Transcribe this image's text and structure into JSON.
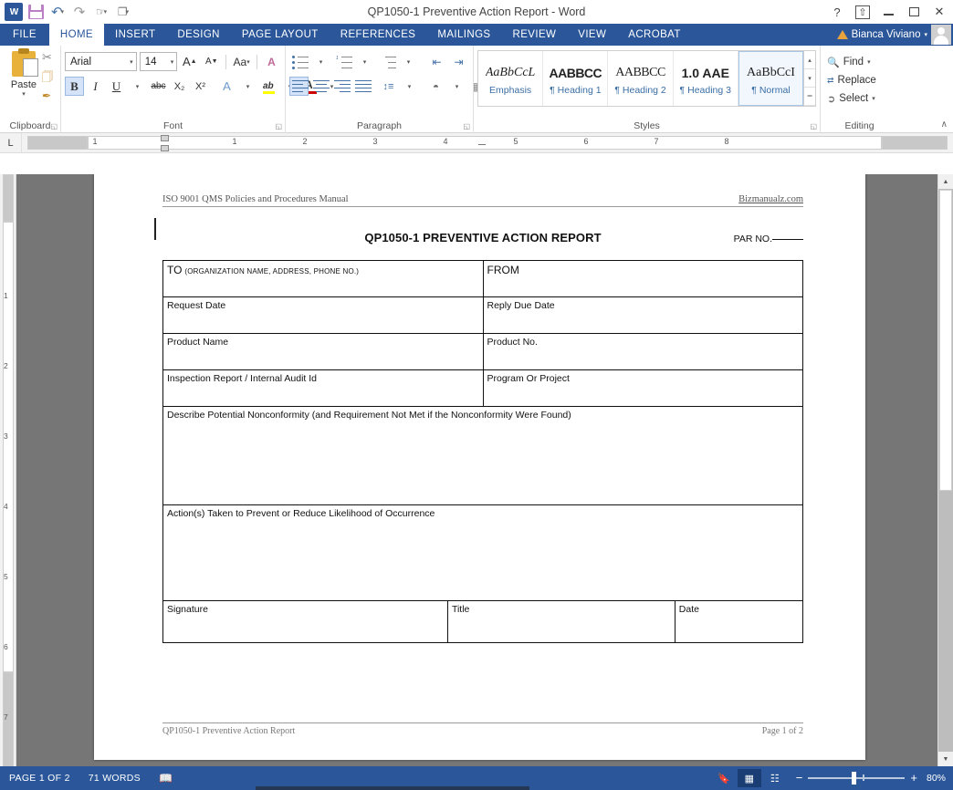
{
  "titlebar": {
    "title": "QP1050-1 Preventive Action Report - Word",
    "quick_access": [
      {
        "name": "word-logo",
        "label": "W"
      },
      {
        "name": "save",
        "label": "save-icon"
      },
      {
        "name": "undo",
        "label": "↶"
      },
      {
        "name": "redo",
        "label": "↻"
      },
      {
        "name": "touch-mode",
        "label": "☚"
      },
      {
        "name": "customize",
        "label": "☰"
      }
    ],
    "help_label": "?",
    "ribbon_display_label": "⬆",
    "minimize_label": "–",
    "restore_label": "□",
    "close_label": "✕"
  },
  "ribbon": {
    "tabs": [
      {
        "label": "FILE",
        "active": false,
        "file": true
      },
      {
        "label": "HOME",
        "active": true
      },
      {
        "label": "INSERT",
        "active": false
      },
      {
        "label": "DESIGN",
        "active": false
      },
      {
        "label": "PAGE LAYOUT",
        "active": false
      },
      {
        "label": "REFERENCES",
        "active": false
      },
      {
        "label": "MAILINGS",
        "active": false
      },
      {
        "label": "REVIEW",
        "active": false
      },
      {
        "label": "VIEW",
        "active": false
      },
      {
        "label": "ACROBAT",
        "active": false
      }
    ],
    "user_name": "Bianca Viviano",
    "user_caret": "▾",
    "collapse_label": "∧",
    "clipboard": {
      "group_label": "Clipboard",
      "paste_label": "Paste",
      "paste_caret": "▾",
      "cut_label": "✂",
      "copy_label": "❐",
      "format_painter_label": "✐",
      "launcher": "◱"
    },
    "font": {
      "group_label": "Font",
      "font_name": "Arial",
      "font_size": "14",
      "grow_label": "A",
      "shrink_label": "A",
      "change_case_label": "Aa",
      "clear_format_label": "A",
      "bold_label": "B",
      "italic_label": "I",
      "underline_label": "U",
      "strikethrough_label": "abc",
      "subscript_label": "X₂",
      "superscript_label": "X²",
      "text_effects_label": "A",
      "highlight_label": "ab",
      "font_color_label": "A",
      "caret": "▾",
      "launcher": "◱"
    },
    "paragraph": {
      "group_label": "Paragraph",
      "bullets_label": "bullets",
      "numbering_label": "numbering",
      "multilevel_label": "multilevel",
      "decrease_indent_label": "decrease-indent",
      "increase_indent_label": "increase-indent",
      "sort_label": "sort",
      "show_marks_label": "¶",
      "align_left_label": "align-left",
      "align_center_label": "align-center",
      "align_right_label": "align-right",
      "justify_label": "justify",
      "line_spacing_label": "line-spacing",
      "shading_label": "shading",
      "borders_label": "borders",
      "caret": "▾",
      "launcher": "◱"
    },
    "styles": {
      "group_label": "Styles",
      "launcher": "◱",
      "items": [
        {
          "preview": "AaBbCcL",
          "name": "Emphasis",
          "class": "sp-emph",
          "selected": false,
          "pilcrow": ""
        },
        {
          "preview": "AABBCC",
          "name": "Heading 1",
          "class": "sp-h1",
          "selected": false,
          "pilcrow": "¶ "
        },
        {
          "preview": "AABBCC",
          "name": "Heading 2",
          "class": "sp-h2",
          "selected": false,
          "pilcrow": "¶ "
        },
        {
          "preview": "1.0 AAE",
          "name": "Heading 3",
          "class": "sp-h3",
          "selected": false,
          "pilcrow": "¶ "
        },
        {
          "preview": "AaBbCcI",
          "name": "Normal",
          "class": "sp-norm",
          "selected": true,
          "pilcrow": "¶ "
        }
      ],
      "scroll_up": "▴",
      "scroll_down": "▾",
      "more": "▾"
    },
    "editing": {
      "group_label": "Editing",
      "find_label": "Find",
      "replace_label": "Replace",
      "select_label": "Select",
      "caret": "▾"
    }
  },
  "ruler": {
    "tabstop_label": "L",
    "h_numbers": [
      "1",
      "1",
      "2",
      "3",
      "4",
      "5",
      "6",
      "7",
      "8"
    ],
    "v_numbers": [
      "1",
      "2",
      "3",
      "4",
      "5",
      "6",
      "7"
    ]
  },
  "document": {
    "header_left": "ISO 9001 QMS Policies and Procedures Manual",
    "header_right": "Bizmanualz.com",
    "title": "QP1050-1 PREVENTIVE ACTION REPORT",
    "par_no_label": "PAR NO.",
    "form_rows": [
      {
        "left_big": "TO",
        "left_small": "(ORGANIZATION NAME, ADDRESS, PHONE NO.)",
        "right": "FROM"
      },
      {
        "left": "Request Date",
        "right": "Reply Due Date"
      },
      {
        "left": "Product Name",
        "right": "Product No."
      },
      {
        "left": "Inspection Report / Internal Audit Id",
        "right": "Program Or Project"
      }
    ],
    "describe_label": "Describe Potential Nonconformity (and Requirement Not Met if the Nonconformity Were Found)",
    "actions_label": "Action(s) Taken to Prevent or Reduce Likelihood of Occurrence",
    "signature_label": "Signature",
    "title_label": "Title",
    "date_label": "Date",
    "footer_left": "QP1050-1 Preventive Action Report",
    "footer_right": "Page 1 of 2"
  },
  "statusbar": {
    "page_label": "PAGE 1 OF 2",
    "words_label": "71 WORDS",
    "proofing_label": "proofing-icon",
    "read_mode_label": "read-mode",
    "print_layout_label": "print-layout",
    "web_layout_label": "web-layout",
    "zoom_out_label": "−",
    "zoom_in_label": "+",
    "zoom_level": "80%"
  },
  "colors": {
    "accent": "#2b579a",
    "ribbon_bg": "#ffffff",
    "doc_bg": "#767676",
    "highlight": "#ffff00",
    "font_color": "#cc0000"
  }
}
